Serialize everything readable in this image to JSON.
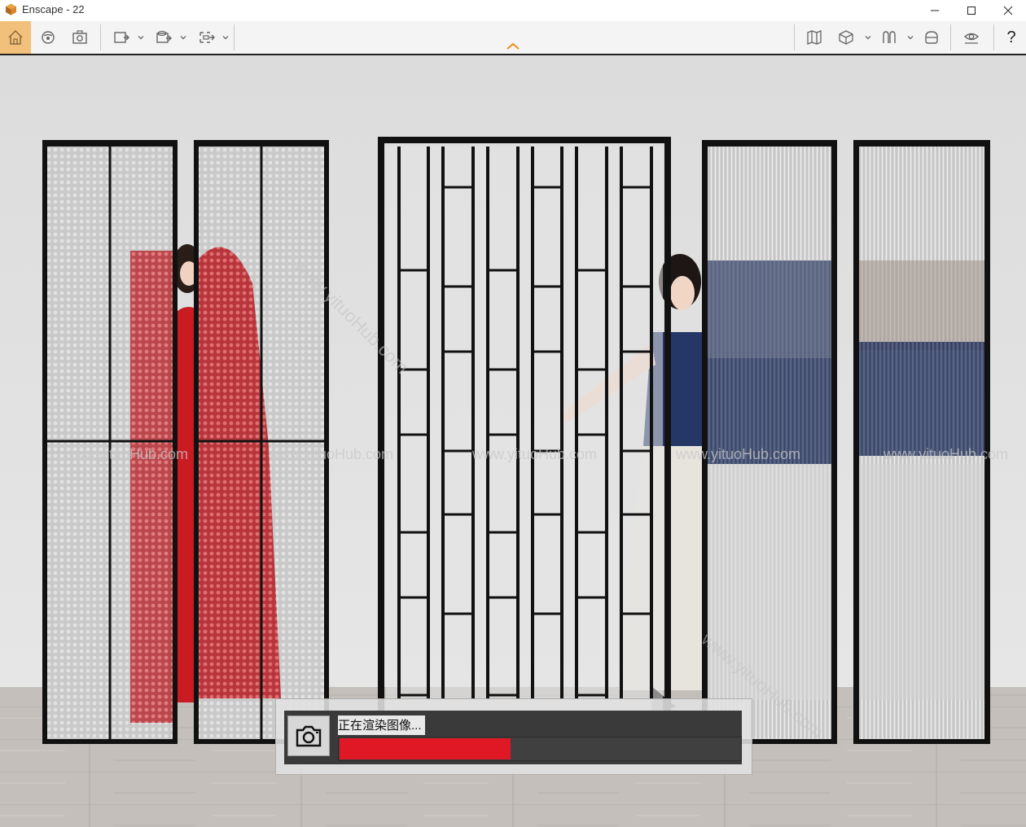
{
  "window": {
    "title": "Enscape - 22",
    "controls": [
      "minimize-icon",
      "maximize-icon",
      "close-icon"
    ]
  },
  "toolbar": {
    "left_icons": [
      "home-icon",
      "orbit-icon",
      "screenshot-icon",
      "export-image-icon",
      "export-video-icon",
      "export-panorama-icon"
    ],
    "right_icons": [
      "map-icon",
      "box-view-icon",
      "asset-library-icon",
      "vr-headset-icon",
      "visual-settings-icon"
    ],
    "help_label": "?",
    "active": "home-icon"
  },
  "watermarks": [
    "www.yituoHub.com",
    "www.yituoHub.com",
    "www.yituoHub.com",
    "www.yituoHub.com",
    "www.yituoHub.com"
  ],
  "render": {
    "status_text": "正在渲染图像...",
    "progress": 0.43,
    "icon": "camera-icon"
  },
  "colors": {
    "accent": "#f1c07a",
    "progress": "#e01826",
    "dress_red": "#c81c22",
    "top_navy": "#253766"
  }
}
